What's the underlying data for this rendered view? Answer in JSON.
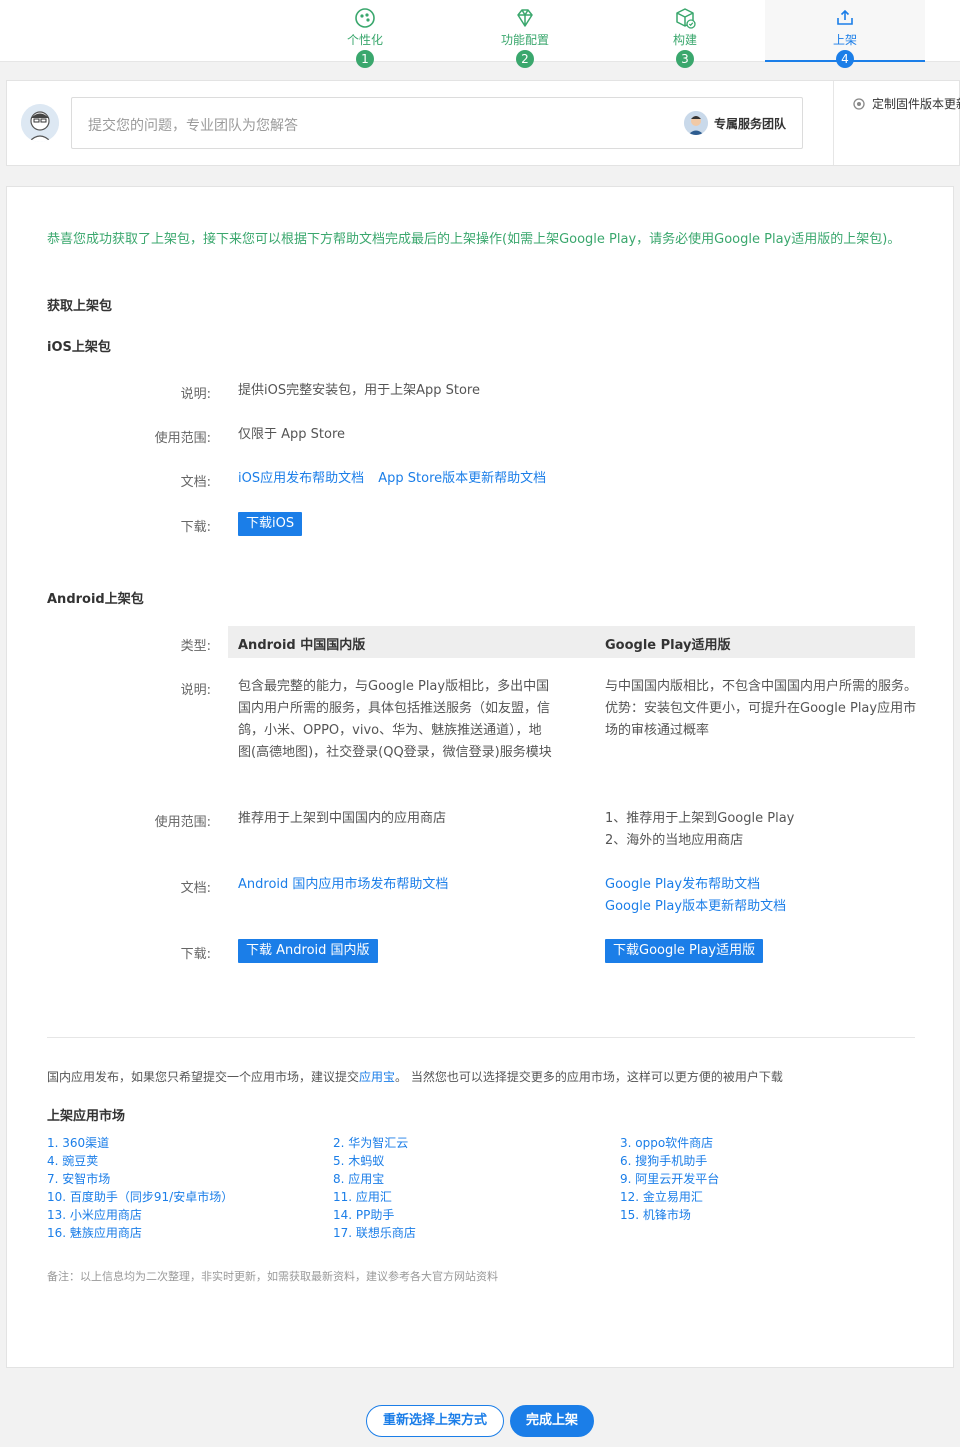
{
  "steps": [
    {
      "label": "个性化",
      "num": "1",
      "icon": "palette-icon"
    },
    {
      "label": "功能配置",
      "num": "2",
      "icon": "diamond-icon"
    },
    {
      "label": "构建",
      "num": "3",
      "icon": "box-check-icon"
    },
    {
      "label": "上架",
      "num": "4",
      "icon": "upload-tray-icon"
    }
  ],
  "support": {
    "placeholder": "提交您的问题，专业团队为您解答",
    "team_label": "专属服务团队",
    "firmware_text": "定制固件版本更新"
  },
  "congrats": "恭喜您成功获取了上架包，接下来您可以根据下方帮助文档完成最后的上架操作(如需上架Google Play，请务必使用Google Play适用版的上架包)。",
  "get_package_title": "获取上架包",
  "ios": {
    "title": "iOS上架包",
    "desc_label": "说明:",
    "desc": "提供iOS完整安装包，用于上架App Store",
    "scope_label": "使用范围:",
    "scope": "仅限于 App Store",
    "docs_label": "文档:",
    "doc1": "iOS应用发布帮助文档",
    "doc2": "App Store版本更新帮助文档",
    "download_label": "下载:",
    "download_btn": "下载iOS"
  },
  "android": {
    "title": "Android上架包",
    "type_label": "类型:",
    "col1_title": "Android 中国国内版",
    "col2_title": "Google Play适用版",
    "desc_label": "说明:",
    "col1_desc": "包含最完整的能力，与Google Play版相比，多出中国国内用户所需的服务，具体包括推送服务（如友盟，信鸽，小米、OPPO，vivo、华为、魅族推送通道），地图(高德地图)，社交登录(QQ登录，微信登录)服务模块",
    "col2_desc": "与中国国内版相比，不包含中国国内用户所需的服务。 优势：安装包文件更小，可提升在Google Play应用市场的审核通过概率",
    "scope_label": "使用范围:",
    "col1_scope": "推荐用于上架到中国国内的应用商店",
    "col2_scope1": "1、推荐用于上架到Google Play",
    "col2_scope2": "2、海外的当地应用商店",
    "docs_label": "文档:",
    "col1_doc": "Android 国内应用市场发布帮助文档",
    "col2_doc1": "Google Play发布帮助文档",
    "col2_doc2": "Google Play版本更新帮助文档",
    "download_label": "下载:",
    "col1_btn": "下载 Android 国内版",
    "col2_btn": "下载Google Play适用版"
  },
  "market": {
    "intro_before": "国内应用发布，如果您只希望提交一个应用市场，建议提交",
    "intro_link": "应用宝",
    "intro_after": "。 当然您也可以选择提交更多的应用市场，这样可以更方便的被用户下载",
    "title": "上架应用市场",
    "col1": [
      "1. 360渠道",
      "4. 豌豆荚",
      "7. 安智市场",
      "10. 百度助手（同步91/安卓市场）",
      "13. 小米应用商店",
      "16. 魅族应用商店"
    ],
    "col2": [
      "2. 华为智汇云",
      "5. 木蚂蚁",
      "8. 应用宝",
      "11. 应用汇",
      "14. PP助手",
      "17. 联想乐商店"
    ],
    "col3": [
      "3. oppo软件商店",
      "6. 搜狗手机助手",
      "9. 阿里云开发平台",
      "12. 金立易用汇",
      "15. 机锋市场"
    ],
    "note": "备注：以上信息均为二次整理，非实时更新，如需获取最新资料，建议参考各大官方网站资料"
  },
  "footer": {
    "reselect": "重新选择上架方式",
    "finish": "完成上架"
  },
  "colors": {
    "accent_blue": "#1b7ee8",
    "accent_green": "#3aa76d"
  }
}
